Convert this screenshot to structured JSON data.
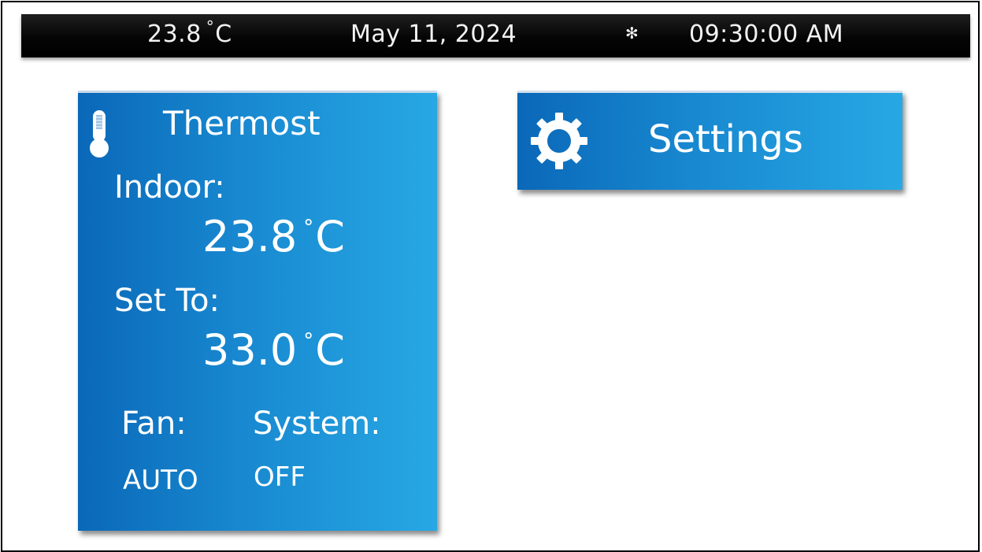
{
  "status_bar": {
    "temperature_value": "23.8",
    "temperature_degree": "°",
    "temperature_unit": "C",
    "date": "May 11, 2024",
    "fan_icon": "fan-icon",
    "fan_glyph": "✻",
    "time": "09:30:00 AM"
  },
  "thermostat": {
    "icon": "thermometer-icon",
    "title": "Thermost",
    "indoor_label": "Indoor:",
    "indoor_value": "23.8",
    "indoor_degree": "°",
    "indoor_unit": "C",
    "setto_label": "Set To:",
    "setto_value": "33.0",
    "setto_degree": "°",
    "setto_unit": "C",
    "fan_label": "Fan:",
    "fan_value": "AUTO",
    "system_label": "System:",
    "system_value": "OFF"
  },
  "settings": {
    "icon": "gear-icon",
    "label": "Settings"
  },
  "colors": {
    "status_bar_bg": "#000000",
    "card_gradient_start": "#0a68b8",
    "card_gradient_end": "#27a8e4",
    "text": "#ffffff"
  }
}
